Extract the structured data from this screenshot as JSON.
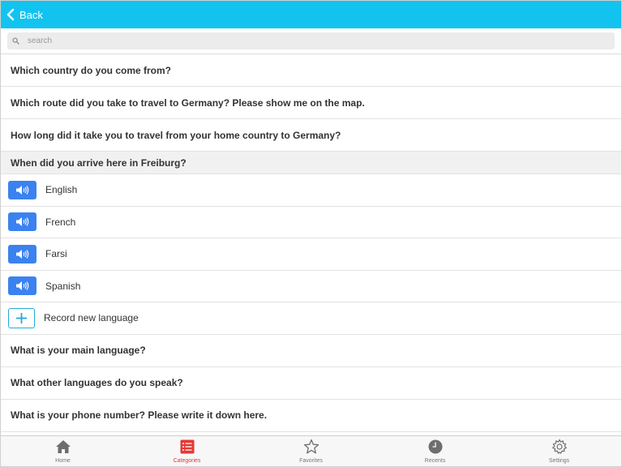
{
  "header": {
    "back_label": "Back"
  },
  "search": {
    "placeholder": "search"
  },
  "questions_top": [
    "Which country do you come from?",
    "Which route did you take to travel to Germany? Please show me on the map.",
    "How long did it take you to travel from your home country to Germany?"
  ],
  "active_question": "When did you arrive here in Freiburg?",
  "languages": [
    "English",
    "French",
    "Farsi",
    "Spanish"
  ],
  "record_label": "Record new language",
  "questions_bottom": [
    "What is your main language?",
    "What other languages do you speak?",
    "What is your phone number? Please write it down here."
  ],
  "tabs": [
    {
      "label": "Home",
      "icon": "home-icon"
    },
    {
      "label": "Categories",
      "icon": "list-icon",
      "selected": true
    },
    {
      "label": "Favorites",
      "icon": "star-icon"
    },
    {
      "label": "Recents",
      "icon": "clock-icon"
    },
    {
      "label": "Settings",
      "icon": "gear-icon"
    }
  ],
  "colors": {
    "header": "#12c3f0",
    "speaker_button": "#3b82f0",
    "selected_tab": "#e53935",
    "add_border": "#26a9d9"
  }
}
